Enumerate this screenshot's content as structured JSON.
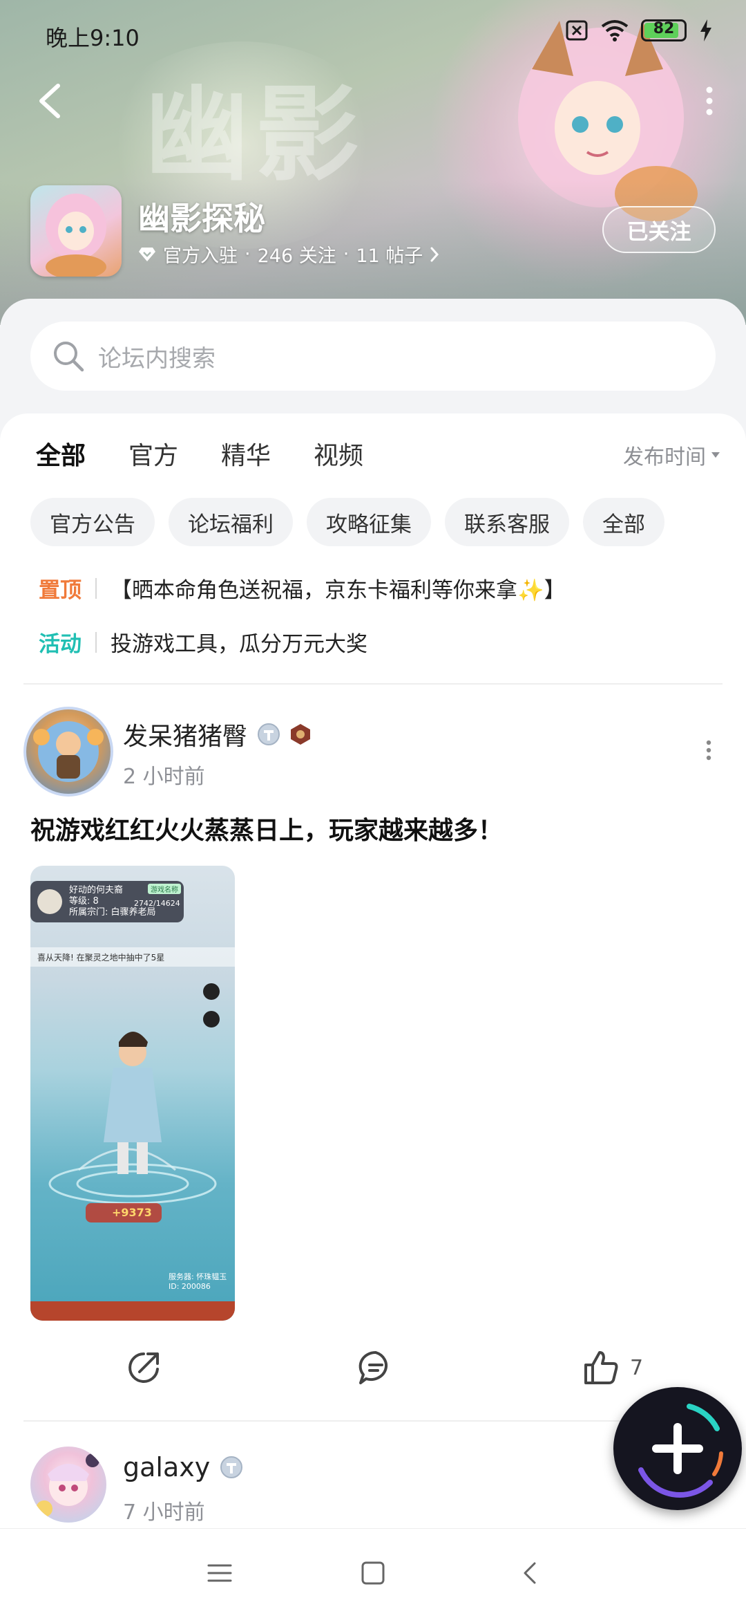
{
  "status_bar": {
    "time": "晚上9:10",
    "battery": "82"
  },
  "hero": {
    "calligraphy": "幽影"
  },
  "forum": {
    "name": "幽影探秘",
    "verified_label": "官方入驻",
    "followers": "246 关注",
    "posts": "11 帖子",
    "dot": "·",
    "follow_state": "已关注"
  },
  "search": {
    "placeholder": "论坛内搜索"
  },
  "tabs": [
    {
      "label": "全部",
      "active": true
    },
    {
      "label": "官方",
      "active": false
    },
    {
      "label": "精华",
      "active": false
    },
    {
      "label": "视频",
      "active": false
    }
  ],
  "sort": {
    "label": "发布时间"
  },
  "chips": [
    "官方公告",
    "论坛福利",
    "攻略征集",
    "联系客服",
    "全部"
  ],
  "notices": [
    {
      "tag": "置顶",
      "tag_color": "#f07a3a",
      "text": "【晒本命角色送祝福，京东卡福利等你来拿✨】"
    },
    {
      "tag": "活动",
      "tag_color": "#20bfb3",
      "text": "投游戏工具，瓜分万元大奖"
    }
  ],
  "post": {
    "user": "发呆猪猪臀",
    "time": "2 小时前",
    "title": "祝游戏红红火火蒸蒸日上，玩家越来越多！",
    "likes": "7",
    "image_text": {
      "player_name": "好动的何夫裔",
      "level": "等级: 8",
      "exp": "2742/14624",
      "sect": "所属宗门: 白骤养老局",
      "badge": "游戏名称",
      "marquee": "喜从天降! 在聚灵之地中抽中了5星",
      "damage": "+9373",
      "server": "服务器: 怀珠韫玉",
      "id": "ID: 200086"
    }
  },
  "post2": {
    "user": "galaxy",
    "time": "7 小时前"
  },
  "colors": {
    "accent": "#22c3b8",
    "pinned": "#f07a3a",
    "activity": "#20bfb3"
  }
}
